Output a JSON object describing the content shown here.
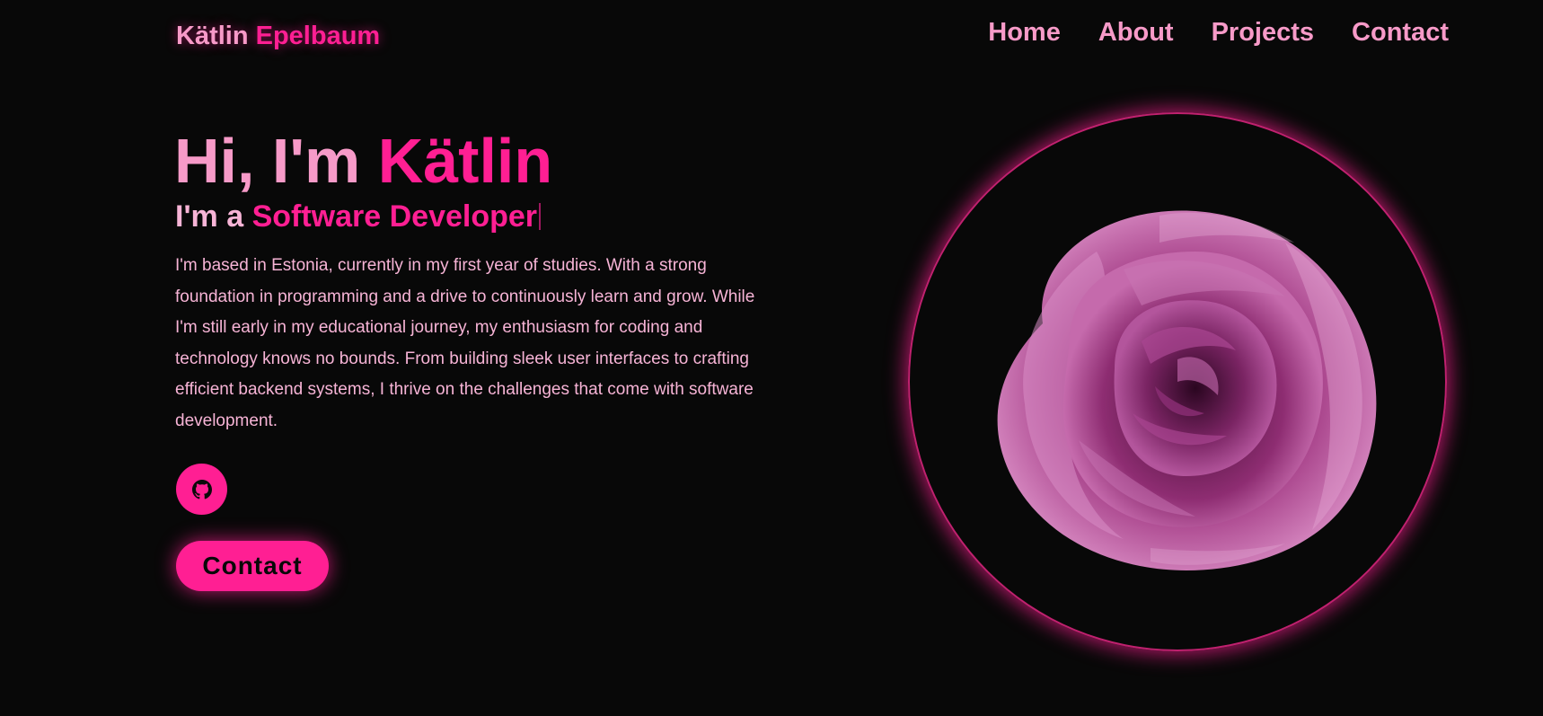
{
  "header": {
    "logo_first": "Kätlin",
    "logo_last": "Epelbaum",
    "nav": [
      {
        "label": "Home"
      },
      {
        "label": "About"
      },
      {
        "label": "Projects"
      },
      {
        "label": "Contact"
      }
    ]
  },
  "hero": {
    "greeting": "Hi, I'm",
    "name": "Kätlin",
    "role_prefix": "I'm a",
    "role": "Software Developer",
    "bio": "I'm based in Estonia, currently in my first year of studies. With a strong foundation in programming and a drive to continuously learn and grow. While I'm still early in my educational journey, my enthusiasm for coding and technology knows no bounds. From building sleek user interfaces to crafting efficient backend systems, I thrive on the challenges that come with software development.",
    "social_icon": "github-icon",
    "contact_button": "Contact"
  },
  "portrait": {
    "subject": "flower-image"
  },
  "colors": {
    "background": "#080808",
    "accent": "#ff1f93",
    "text_pink": "#f79ac8",
    "body_text": "#f7b4d6"
  }
}
